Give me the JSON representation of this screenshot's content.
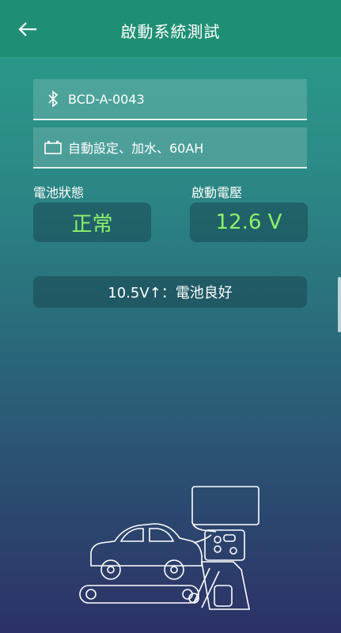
{
  "header": {
    "title": "啟動系統測試",
    "back_icon": "arrow-left-icon"
  },
  "device": {
    "name": "BCD-A-0043",
    "icon": "bluetooth-icon"
  },
  "battery_setting": {
    "text": "自動設定、加水、60AH",
    "icon": "battery-icon"
  },
  "battery_status": {
    "label": "電池狀態",
    "value": "正常"
  },
  "cranking_voltage": {
    "label": "啟動電壓",
    "value": "12.6 V"
  },
  "result": {
    "text": "10.5V↑：電池良好"
  },
  "colors": {
    "accent_value": "#8df26b",
    "appbar": "#1f8f74"
  }
}
